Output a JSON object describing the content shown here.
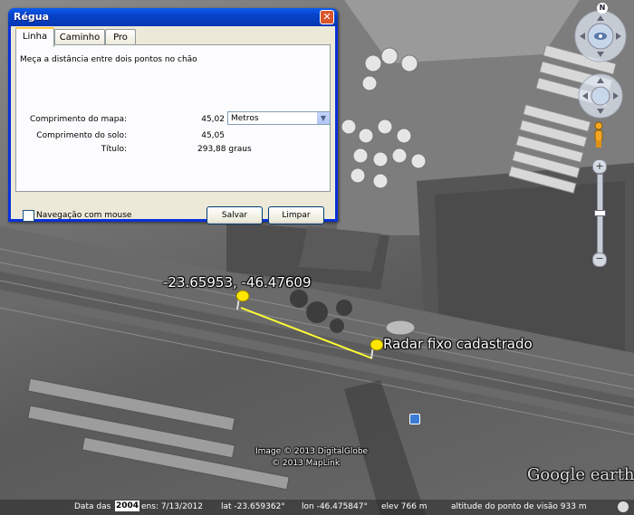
{
  "dialog": {
    "title": "Régua",
    "close_glyph": "✕",
    "tabs": [
      {
        "label": "Linha"
      },
      {
        "label": "Caminho"
      },
      {
        "label": "Pro"
      }
    ],
    "instruction": "Meça a distância entre dois pontos no chão",
    "map_length_label": "Comprimento do mapa:",
    "map_length_value": "45,02",
    "unit_select_value": "Metros",
    "ground_length_label": "Comprimento do solo:",
    "ground_length_value": "45,05",
    "heading_label": "Título:",
    "heading_value": "293,88 graus",
    "mouse_nav_label": "Navegação com mouse",
    "mouse_nav_checked": false,
    "save_button": "Salvar",
    "clear_button": "Limpar"
  },
  "map": {
    "placemark1_label": "-23.65953, -46.47609",
    "placemark2_label": "Radar fixo cadastrado",
    "credit_line1": "Image © 2013 DigitalGlobe",
    "credit_line2": "© 2013 MapLink",
    "logo_text": "Google earth",
    "line_color": "#ffff33",
    "arrow_color": "#e8101a"
  },
  "nav": {
    "north_label": "N",
    "zoom_in": "+",
    "zoom_out": "−"
  },
  "status": {
    "date_label": "Data das",
    "imagery_year": "2004",
    "date_value": "ens: 7/13/2012",
    "lat": "lat  -23.659362°",
    "lon": "lon  -46.475847°",
    "elev": "elev   766 m",
    "eye_alt": "altitude do ponto de visão   933 m"
  }
}
